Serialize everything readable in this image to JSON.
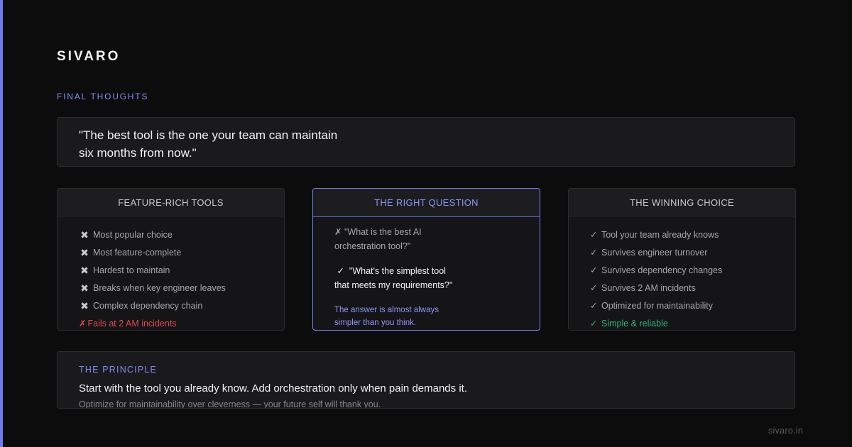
{
  "brand": "SIVARO",
  "section_label": "FINAL THOUGHTS",
  "quote": "\"The best tool is the one your team can maintain\nsix months from now.\"",
  "cards": {
    "feature_rich": {
      "title": "FEATURE-RICH TOOLS",
      "items": [
        "Most popular choice",
        "Most feature-complete",
        "Hardest to maintain",
        "Breaks when key engineer leaves",
        "Complex dependency chain"
      ],
      "bad_item": "Fails at 2 AM incidents",
      "item_icon": "heavy-x-icon",
      "bad_mark": "✗"
    },
    "right_question": {
      "title": "THE RIGHT QUESTION",
      "wrong_mark": "✗",
      "wrong_question": "\"What is the best AI\norchestration tool?\"",
      "right_mark": "✓",
      "right_question": "\"What's the simplest tool\nthat meets my requirements?\"",
      "answer": "The answer is almost always\nsimpler than you think."
    },
    "winning_choice": {
      "title": "THE WINNING CHOICE",
      "check_mark": "✓",
      "items": [
        "Tool your team already knows",
        "Survives engineer turnover",
        "Survives dependency changes",
        "Survives 2 AM incidents",
        "Optimized for maintainability"
      ],
      "good_item": "Simple & reliable"
    }
  },
  "principle": {
    "label": "THE PRINCIPLE",
    "main": "Start with the tool you already know. Add orchestration only when pain demands it.",
    "sub": "Optimize for maintainability over cleverness — your future self will thank you."
  },
  "footer": "sivaro.in",
  "colors": {
    "background": "#0c0c0d",
    "accent": "#6f7cf0",
    "bad": "#e0494d",
    "good": "#2fb57b"
  }
}
